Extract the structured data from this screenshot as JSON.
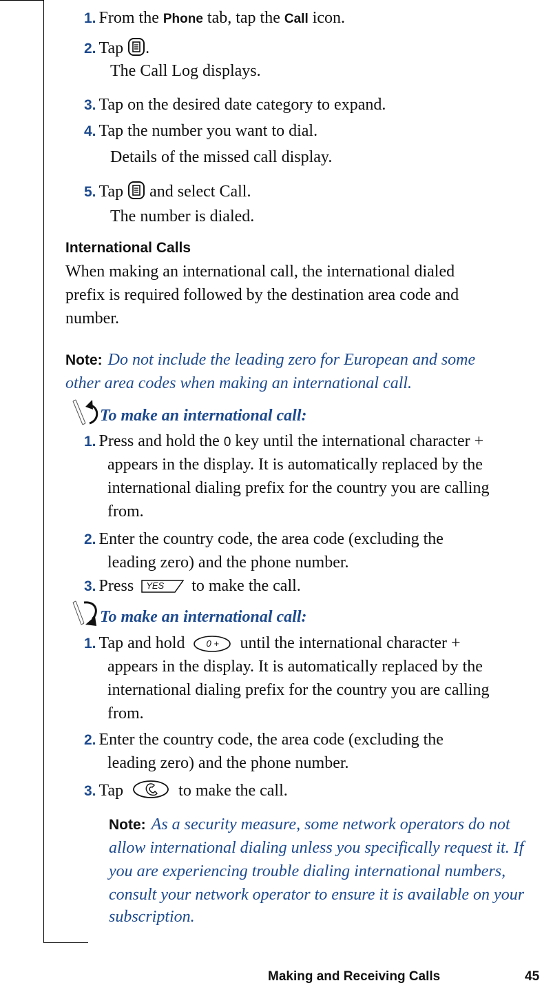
{
  "section1": {
    "steps": [
      {
        "num": "1.",
        "parts": [
          "From the ",
          "Phone",
          " tab, tap the ",
          "Call",
          " icon."
        ]
      },
      {
        "num": "2.",
        "prefix": "Tap ",
        "suffix": ".",
        "icon": "menu-icon",
        "result": "The Call Log displays."
      },
      {
        "num": "3.",
        "text": "Tap on the desired date category to expand."
      },
      {
        "num": "4.",
        "text": "Tap the number you want to dial.",
        "result": "Details of the missed call display."
      },
      {
        "num": "5.",
        "prefix": "Tap ",
        "suffix": " and select Call.",
        "icon": "menu-icon",
        "result": "The number is dialed."
      }
    ]
  },
  "international": {
    "heading": "International Calls",
    "body": [
      "When making an international call, the international dialed",
      "prefix is required followed by the destination area code and",
      "number."
    ],
    "note": {
      "label": "Note:",
      "lines": [
        "Do not include the leading zero for European and some",
        "other area codes when making an international call."
      ]
    }
  },
  "procedure_keypad": {
    "icon": "stylus-counterclockwise-icon",
    "title": "To make an international call:",
    "steps": [
      {
        "num": "1.",
        "lines": [
          "Press and hold the ",
          "0",
          " key until the international character +",
          "appears in the display. It is automatically replaced by the",
          "international dialing prefix for the country you are calling",
          "from."
        ]
      },
      {
        "num": "2.",
        "lines": [
          "Enter the country code, the area code (excluding the",
          "leading zero) and the phone number."
        ]
      },
      {
        "num": "3.",
        "prefix": "Press ",
        "key_label": "YES",
        "suffix": " to make the call."
      }
    ]
  },
  "procedure_touch": {
    "icon": "stylus-clockwise-icon",
    "title": "To make an international call:",
    "steps": [
      {
        "num": "1.",
        "prefix": "Tap and hold ",
        "key_label": "0 +",
        "suffix": " until the international character +",
        "lines": [
          "appears in the display. It is automatically replaced by the",
          "international dialing prefix for the country you are calling",
          "from."
        ]
      },
      {
        "num": "2.",
        "lines": [
          "Enter the country code, the area code (excluding the",
          "leading zero) and the phone number."
        ]
      },
      {
        "num": "3.",
        "prefix": "Tap ",
        "suffix": " to make the call.",
        "icon": "phone-handset-icon"
      }
    ],
    "note": {
      "label": "Note:",
      "lines": [
        "As a security measure, some network operators do not",
        "allow international dialing unless you specifically request it. If",
        "you are experiencing trouble dialing international numbers,",
        "consult your network operator to ensure it is available on your",
        "subscription."
      ]
    }
  },
  "footer": {
    "section_title": "Making and Receiving Calls",
    "page_number": "45"
  },
  "colors": {
    "accent_blue": "#1d4a8e",
    "text": "#111111"
  }
}
